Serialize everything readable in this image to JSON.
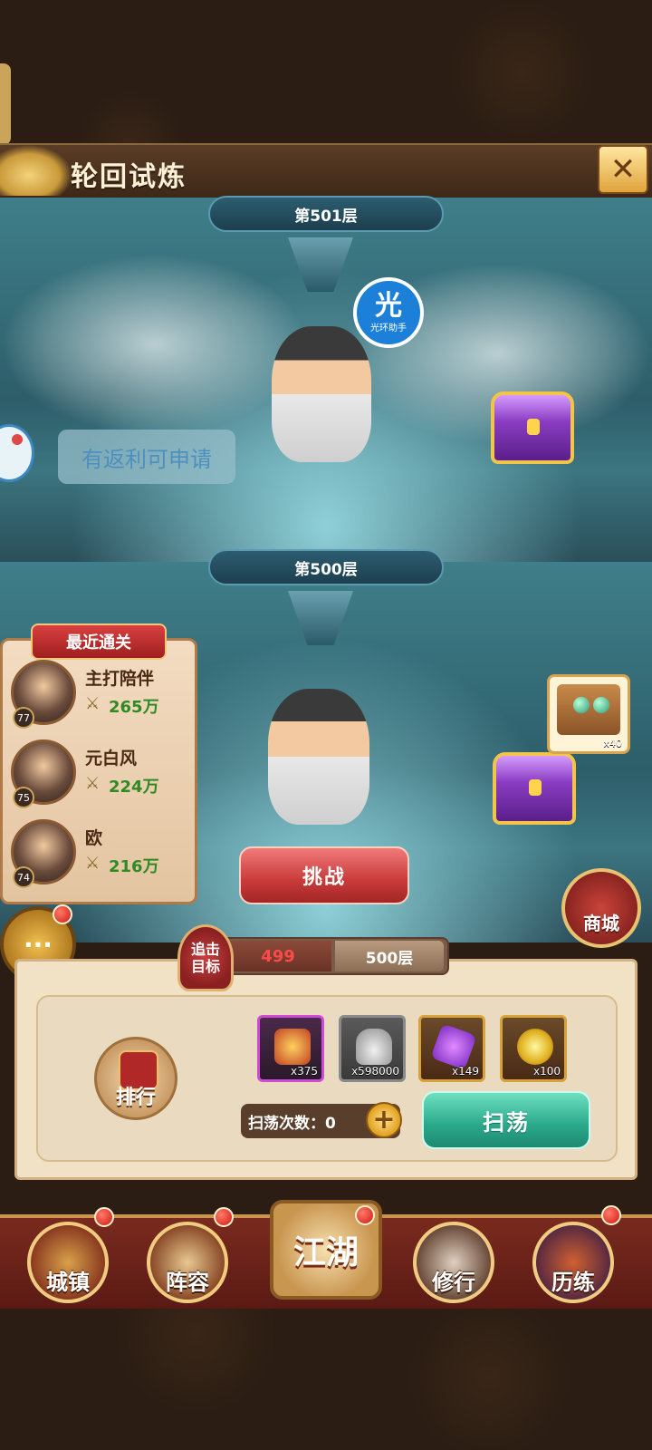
{
  "header": {
    "title": "轮回试炼",
    "close_icon": "close-icon"
  },
  "floors": {
    "upper": "第501层",
    "lower": "第500层"
  },
  "halo": {
    "big": "光",
    "small": "光环助手"
  },
  "speech": {
    "text": "有返利可申请"
  },
  "recent": {
    "title": "最近通关",
    "players": [
      {
        "level": "77",
        "name": "主打陪伴",
        "score": "265万"
      },
      {
        "level": "75",
        "name": "元白风",
        "score": "224万"
      },
      {
        "level": "74",
        "name": "欧",
        "score": "216万"
      }
    ]
  },
  "challenge": {
    "label": "挑战"
  },
  "reward": {
    "count": "x40"
  },
  "shop": {
    "label": "商城"
  },
  "chat": {
    "icon": "chat-icon",
    "glyph": "···"
  },
  "target": {
    "line1": "追击",
    "line2": "目标",
    "current": "499",
    "goal": "500层"
  },
  "rank": {
    "label": "排行"
  },
  "items": [
    {
      "name": "token-icon",
      "count": "x375",
      "color": "#b13ab8"
    },
    {
      "name": "silver-ingot-icon",
      "count": "x598000",
      "color": "#6b6b6b"
    },
    {
      "name": "purple-crystal-icon",
      "count": "x149",
      "color": "#d8a23a"
    },
    {
      "name": "gold-orb-icon",
      "count": "x100",
      "color": "#d8a23a"
    }
  ],
  "sweep": {
    "count_label": "扫荡次数：0",
    "plus": "+",
    "button": "扫荡"
  },
  "nav": {
    "town": "城镇",
    "lineup": "阵容",
    "jianghu": "江湖",
    "practice": "修行",
    "trial": "历练"
  },
  "colors": {
    "accent_red": "#c93a3a",
    "accent_green": "#2aa88a",
    "gold": "#f0cc80"
  }
}
